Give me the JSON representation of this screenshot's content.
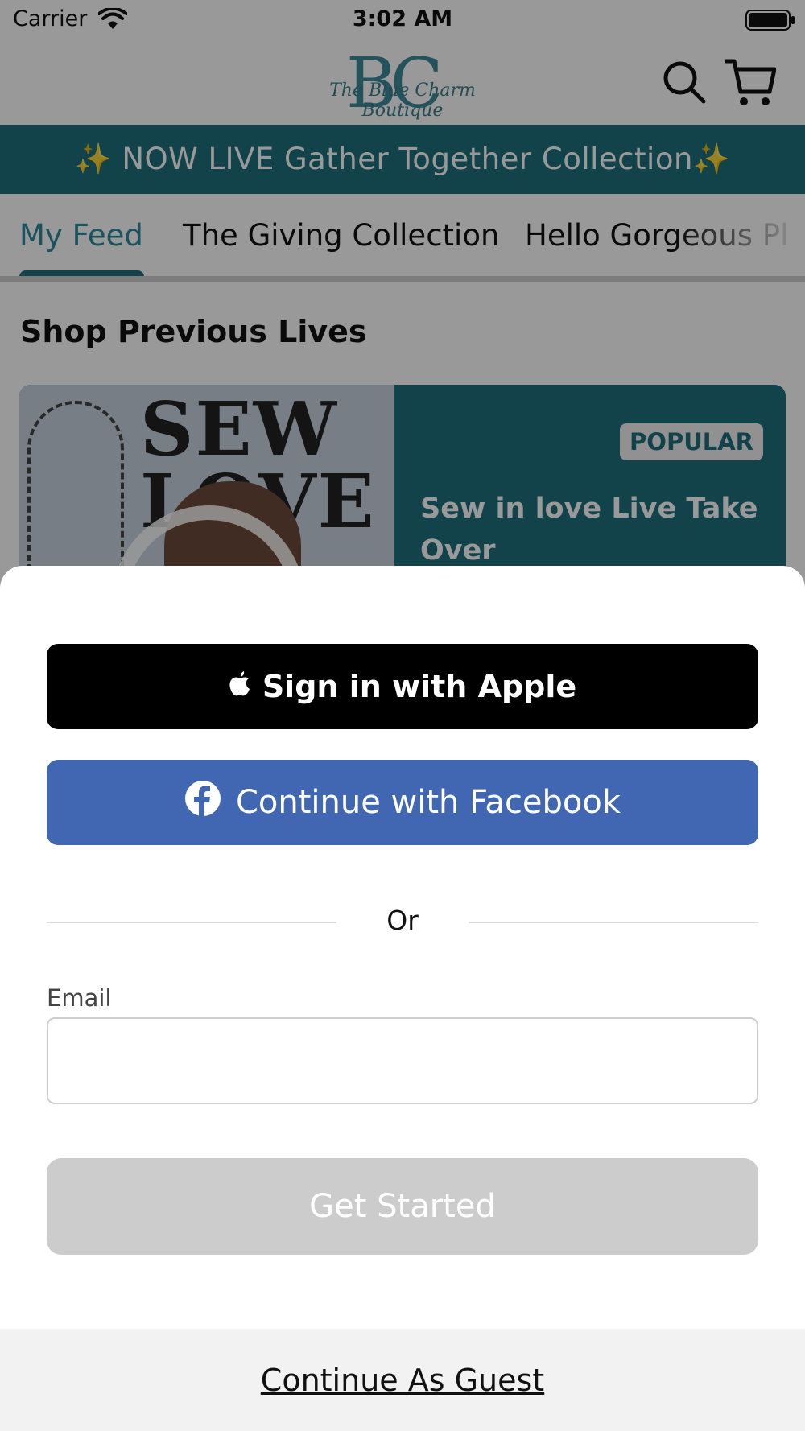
{
  "status_bar": {
    "carrier": "Carrier",
    "time": "3:02 AM"
  },
  "header": {
    "logo_monogram": "BC",
    "logo_script": "The Blue Charm Boutique"
  },
  "banner": {
    "text": "✨ NOW LIVE Gather Together Collection✨"
  },
  "tabs": [
    {
      "label": "My Feed",
      "active": true
    },
    {
      "label": "The Giving Collection",
      "active": false
    },
    {
      "label": "Hello Gorgeous Pl",
      "active": false
    }
  ],
  "section": {
    "title": "Shop Previous Lives"
  },
  "card": {
    "badge": "POPULAR",
    "title": "Sew in love Live Take Over",
    "image_lettering": "SEW\nLOVE"
  },
  "sheet": {
    "apple_button": "Sign in with Apple",
    "facebook_button": "Continue with Facebook",
    "divider": "Or",
    "email_label": "Email",
    "email_value": "",
    "get_started": "Get Started",
    "guest": "Continue As Guest"
  },
  "colors": {
    "brand_teal": "#1f6f7c",
    "tab_active": "#2a8a9b",
    "facebook_blue": "#4267b2",
    "disabled_button": "#cccccc"
  }
}
